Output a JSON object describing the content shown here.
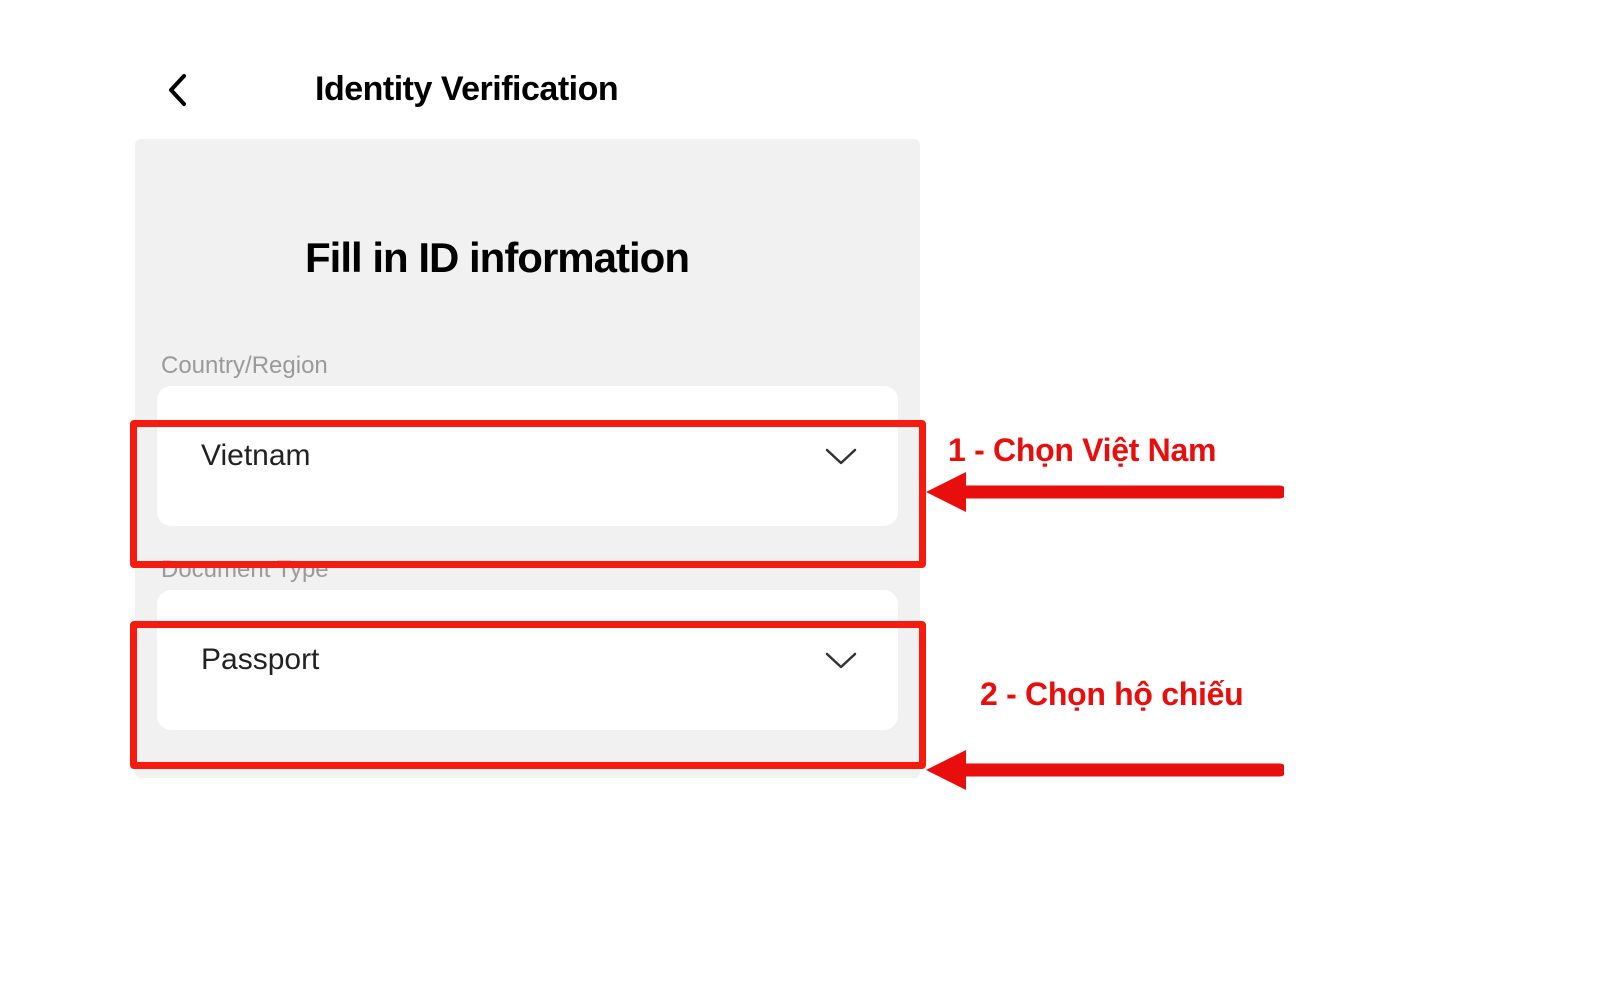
{
  "header": {
    "title": "Identity Verification"
  },
  "panel": {
    "title": "Fill in ID information"
  },
  "fields": {
    "country": {
      "label": "Country/Region",
      "value": "Vietnam"
    },
    "document": {
      "label": "Document Type",
      "value": "Passport"
    }
  },
  "annotations": {
    "step1": "1 - Chọn Việt Nam",
    "step2": "2 - Chọn hộ chiếu"
  },
  "colors": {
    "annotation_red": "#e80e0e",
    "frame_red": "#f61b0e",
    "panel_bg": "#f1f1f1",
    "label_gray": "#9a9a9a"
  }
}
